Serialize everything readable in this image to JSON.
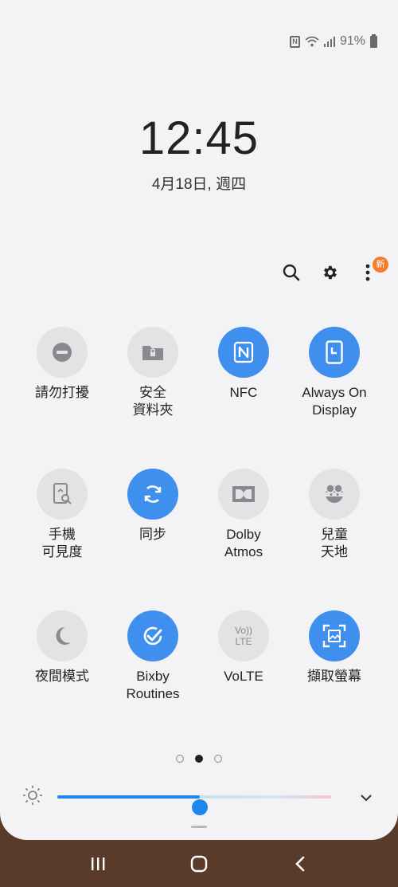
{
  "status_bar": {
    "battery_percent": "91%",
    "icons": [
      "nfc-icon",
      "wifi-icon",
      "signal-icon",
      "battery-icon"
    ]
  },
  "clock": {
    "time": "12:45",
    "date": "4月18日, 週四"
  },
  "toolbar": {
    "icons": [
      "search-icon",
      "gear-icon",
      "more-vert-icon"
    ],
    "badge": "新"
  },
  "quick_settings": [
    {
      "label": "請勿打擾",
      "icon": "do-not-disturb-icon",
      "active": false
    },
    {
      "label": "安全\n資料夾",
      "icon": "secure-folder-icon",
      "active": false
    },
    {
      "label": "NFC",
      "icon": "nfc-icon",
      "active": true
    },
    {
      "label": "Always On\nDisplay",
      "icon": "always-on-display-icon",
      "active": true
    },
    {
      "label": "手機\n可見度",
      "icon": "phone-visibility-icon",
      "active": false
    },
    {
      "label": "同步",
      "icon": "sync-icon",
      "active": true
    },
    {
      "label": "Dolby\nAtmos",
      "icon": "dolby-atmos-icon",
      "active": false
    },
    {
      "label": "兒童\n天地",
      "icon": "kids-home-icon",
      "active": false
    },
    {
      "label": "夜間模式",
      "icon": "night-mode-icon",
      "active": false
    },
    {
      "label": "Bixby\nRoutines",
      "icon": "bixby-routines-icon",
      "active": true
    },
    {
      "label": "VoLTE",
      "icon": "volte-icon",
      "active": false
    },
    {
      "label": "擷取螢幕",
      "icon": "screenshot-icon",
      "active": true
    }
  ],
  "volte_icon_text": [
    "Vo))",
    "LTE"
  ],
  "page_indicator": {
    "count": 3,
    "active": 1
  },
  "brightness": {
    "level": 0.52,
    "icon": "brightness-icon",
    "expand_icon": "chevron-down-icon"
  },
  "nav_bar": {
    "icons": [
      "recents-icon",
      "home-icon",
      "back-icon"
    ]
  },
  "colors": {
    "accent": "#3f8fef",
    "slider": "#1f86ee",
    "badge": "#f57c2a",
    "panel": "#f3f3f5"
  }
}
